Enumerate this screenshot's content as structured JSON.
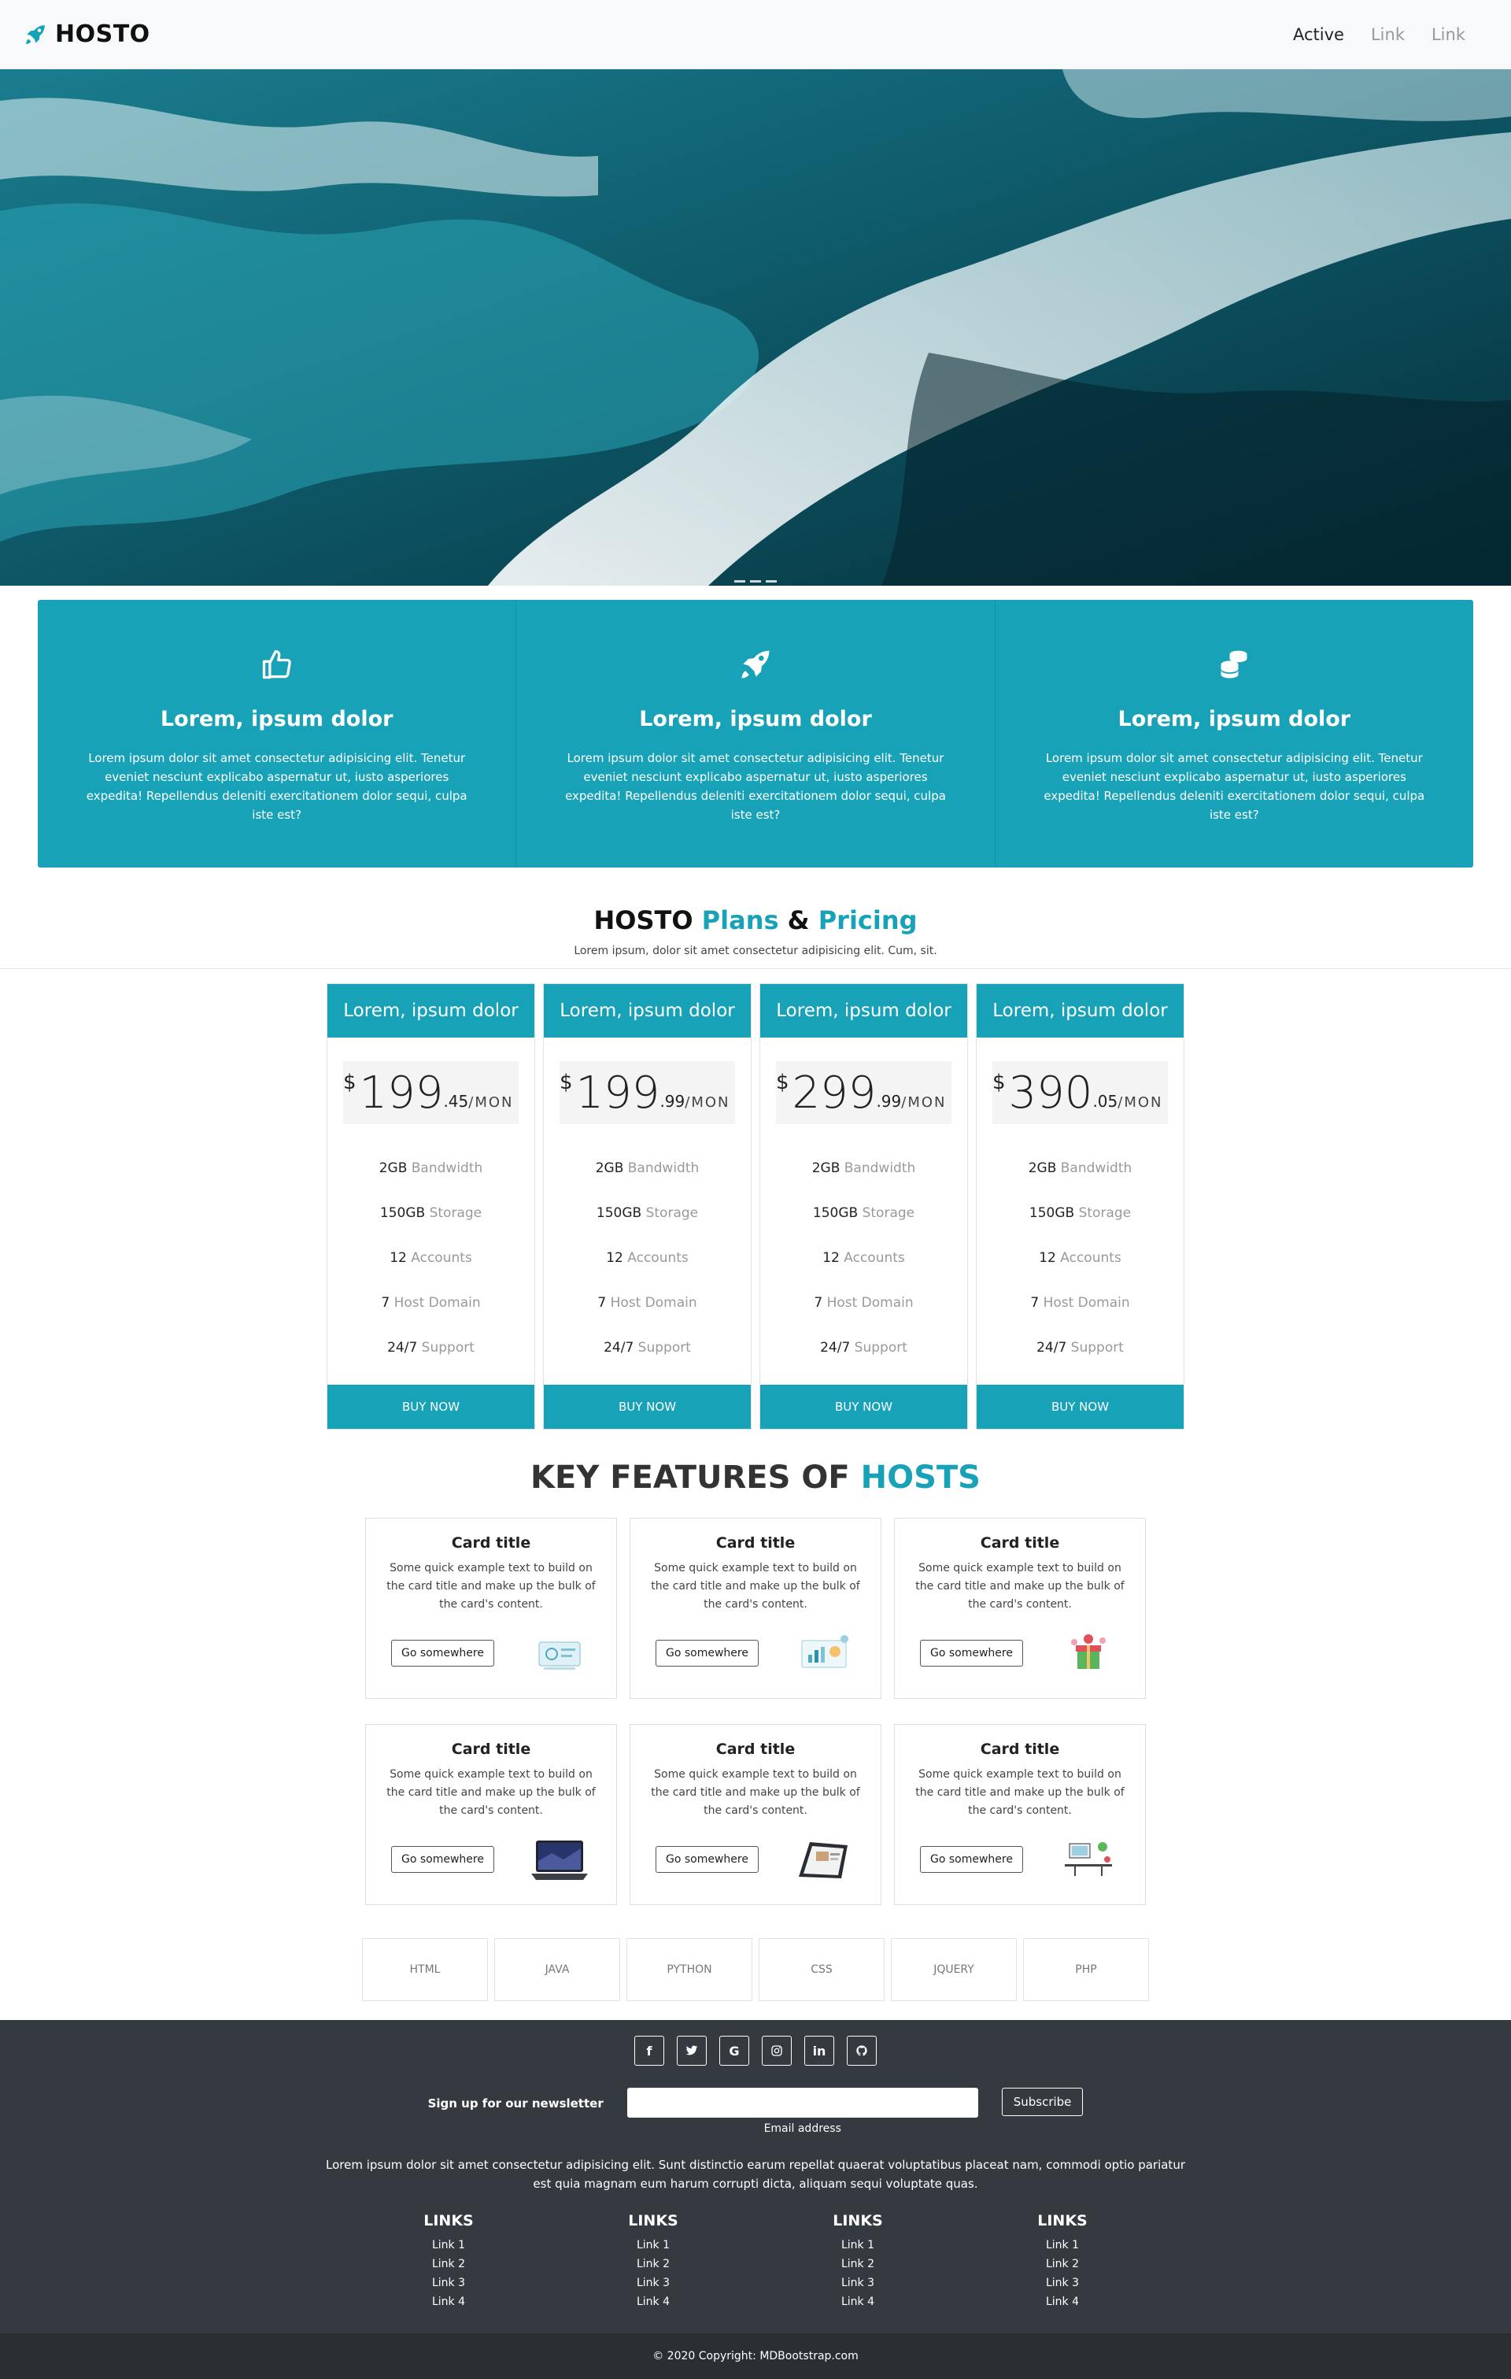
{
  "navbar": {
    "brand": "HOSTO",
    "links": [
      "Active",
      "Link",
      "Link"
    ]
  },
  "info": [
    {
      "title": "Lorem, ipsum dolor",
      "text": "Lorem ipsum dolor sit amet consectetur adipisicing elit. Tenetur eveniet nesciunt explicabo aspernatur ut, iusto asperiores expedita! Repellendus deleniti exercitationem dolor sequi, culpa iste est?",
      "icon": "thumbs-up-icon"
    },
    {
      "title": "Lorem, ipsum dolor",
      "text": "Lorem ipsum dolor sit amet consectetur adipisicing elit. Tenetur eveniet nesciunt explicabo aspernatur ut, iusto asperiores expedita! Repellendus deleniti exercitationem dolor sequi, culpa iste est?",
      "icon": "rocket-icon"
    },
    {
      "title": "Lorem, ipsum dolor",
      "text": "Lorem ipsum dolor sit amet consectetur adipisicing elit. Tenetur eveniet nesciunt explicabo aspernatur ut, iusto asperiores expedita! Repellendus deleniti exercitationem dolor sequi, culpa iste est?",
      "icon": "coins-icon"
    }
  ],
  "pricing": {
    "title_a": "HOSTO ",
    "title_b": "Plans",
    "title_c": " & ",
    "title_d": "Pricing",
    "subtitle": "Lorem ipsum, dolor sit amet consectetur adipisicing elit. Cum, sit.",
    "cards": [
      {
        "head": "Lorem, ipsum dolor",
        "currency": "$",
        "main": "199",
        "cents": ".45",
        "per": "/MON"
      },
      {
        "head": "Lorem, ipsum dolor",
        "currency": "$",
        "main": "199",
        "cents": ".99",
        "per": "/MON"
      },
      {
        "head": "Lorem, ipsum dolor",
        "currency": "$",
        "main": "299",
        "cents": ".99",
        "per": "/MON"
      },
      {
        "head": "Lorem, ipsum dolor",
        "currency": "$",
        "main": "390",
        "cents": ".05",
        "per": "/MON"
      }
    ],
    "features": [
      {
        "value": "2GB",
        "label": " Bandwidth"
      },
      {
        "value": "150GB",
        "label": " Storage"
      },
      {
        "value": "12",
        "label": " Accounts"
      },
      {
        "value": "7",
        "label": " Host Domain"
      },
      {
        "value": "24/7",
        "label": " Support"
      }
    ],
    "buy_label": "BUY NOW"
  },
  "key_features": {
    "title_a": "KEY FEATURES OF ",
    "title_b": "HOSTS",
    "cards": [
      {
        "title": "Card title",
        "text": "Some quick example text to build on the card title and make up the bulk of the card's content.",
        "button": "Go somewhere",
        "image": "server-illustration"
      },
      {
        "title": "Card title",
        "text": "Some quick example text to build on the card title and make up the bulk of the card's content.",
        "button": "Go somewhere",
        "image": "analytics-illustration"
      },
      {
        "title": "Card title",
        "text": "Some quick example text to build on the card title and make up the bulk of the card's content.",
        "button": "Go somewhere",
        "image": "gift-illustration"
      },
      {
        "title": "Card title",
        "text": "Some quick example text to build on the card title and make up the bulk of the card's content.",
        "button": "Go somewhere",
        "image": "laptop-photo"
      },
      {
        "title": "Card title",
        "text": "Some quick example text to build on the card title and make up the bulk of the card's content.",
        "button": "Go somewhere",
        "image": "tablet-photo"
      },
      {
        "title": "Card title",
        "text": "Some quick example text to build on the card title and make up the bulk of the card's content.",
        "button": "Go somewhere",
        "image": "workspace-illustration"
      }
    ]
  },
  "tech": [
    "HTML",
    "JAVA",
    "PYTHON",
    "CSS",
    "JQUERY",
    "PHP"
  ],
  "footer": {
    "social": [
      "facebook-icon",
      "twitter-icon",
      "google-icon",
      "instagram-icon",
      "linkedin-icon",
      "github-icon"
    ],
    "newsletter_label": "Sign up for our newsletter",
    "email_caption": "Email address",
    "subscribe_label": "Subscribe",
    "text": "Lorem ipsum dolor sit amet consectetur adipisicing elit. Sunt distinctio earum repellat quaerat voluptatibus placeat nam, commodi optio pariatur est quia magnam eum harum corrupti dicta, aliquam sequi voluptate quas.",
    "link_cols": [
      {
        "title": "LINKS",
        "items": [
          "Link 1",
          "Link 2",
          "Link 3",
          "Link 4"
        ]
      },
      {
        "title": "LINKS",
        "items": [
          "Link 1",
          "Link 2",
          "Link 3",
          "Link 4"
        ]
      },
      {
        "title": "LINKS",
        "items": [
          "Link 1",
          "Link 2",
          "Link 3",
          "Link 4"
        ]
      },
      {
        "title": "LINKS",
        "items": [
          "Link 1",
          "Link 2",
          "Link 3",
          "Link 4"
        ]
      }
    ],
    "copyright": "© 2020 Copyright: MDBootstrap.com"
  },
  "colors": {
    "accent": "#17a2b8",
    "footer_bg": "#343a40",
    "copyright_bg": "#2b2f34"
  }
}
